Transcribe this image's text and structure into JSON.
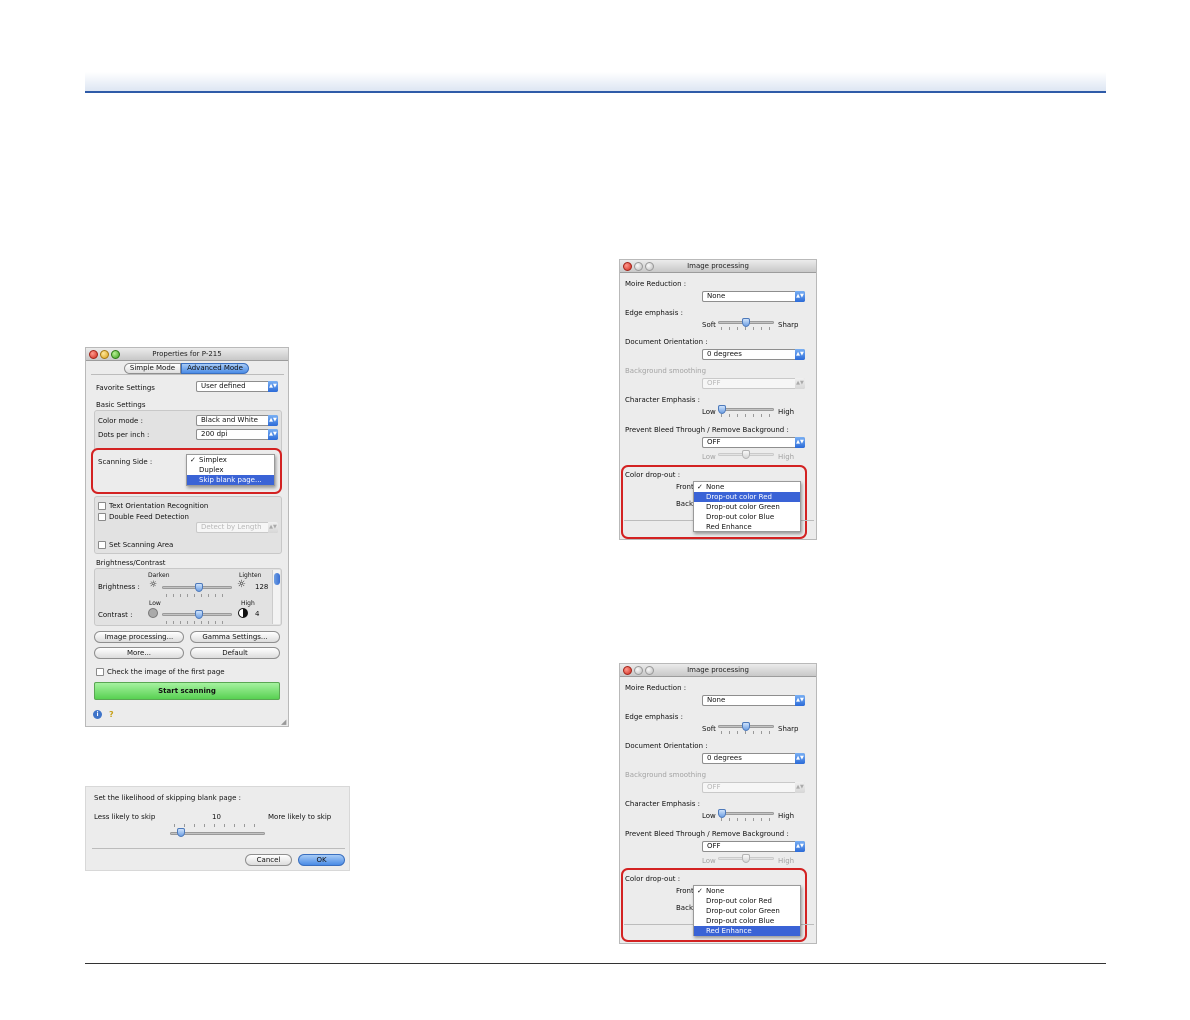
{
  "props": {
    "title": "Properties for P-215",
    "tabs": [
      "Simple Mode",
      "Advanced Mode"
    ],
    "favorite_label": "Favorite Settings",
    "favorite_value": "User defined",
    "basic_settings": "Basic Settings",
    "color_mode_label": "Color mode :",
    "color_mode_value": "Black and White",
    "dpi_label": "Dots per inch :",
    "dpi_value": "200 dpi",
    "scanning_side_label": "Scanning Side :",
    "scanning_side_options": [
      "Simplex",
      "Duplex",
      "Skip blank page..."
    ],
    "scanning_side_checked": "✓",
    "text_orientation": "Text Orientation Recognition",
    "double_feed": "Double Feed Detection",
    "detect_value": "Detect by Length",
    "set_area": "Set Scanning Area",
    "brightness_contrast": "Brightness/Contrast",
    "darken": "Darken",
    "lighten": "Lighten",
    "brightness_label": "Brightness :",
    "brightness_value": "128",
    "low": "Low",
    "high": "High",
    "contrast_label": "Contrast :",
    "contrast_value": "4",
    "image_processing_btn": "Image processing...",
    "gamma_btn": "Gamma Settings...",
    "more_btn": "More...",
    "default_btn": "Default",
    "check_first_page": "Check the image of the first page",
    "start_btn": "Start scanning"
  },
  "skip_dialog": {
    "prompt": "Set the likelihood of skipping blank page :",
    "less": "Less likely to skip",
    "value": "10",
    "more": "More likely to skip",
    "cancel": "Cancel",
    "ok": "OK"
  },
  "image_processing": {
    "title": "Image processing",
    "moire_label": "Moire Reduction :",
    "moire_value": "None",
    "edge_label": "Edge emphasis :",
    "soft": "Soft",
    "sharp": "Sharp",
    "orientation_label": "Document Orientation :",
    "orientation_value": "0 degrees",
    "bg_smoothing_label": "Background smoothing",
    "bg_smoothing_value": "OFF",
    "char_emphasis_label": "Character Emphasis :",
    "low": "Low",
    "high": "High",
    "bleed_label": "Prevent Bleed Through / Remove Background :",
    "bleed_value": "OFF",
    "dropout_label": "Color drop-out :",
    "front": "Front",
    "back": "Back",
    "options": [
      "None",
      "Drop-out color Red",
      "Drop-out color Green",
      "Drop-out color Blue",
      "Red Enhance"
    ],
    "checked_mark": "✓"
  },
  "colors": {
    "highlight": "#3a63d6",
    "red_outline": "#d32222",
    "header_rule": "#2f5ba8",
    "start_green": "#58d152"
  },
  "icons": [
    "close-light",
    "minimize-light",
    "zoom-light",
    "info-icon",
    "help-icon",
    "sun-dim-icon",
    "sun-bright-icon",
    "contrast-low-icon",
    "contrast-high-icon"
  ]
}
